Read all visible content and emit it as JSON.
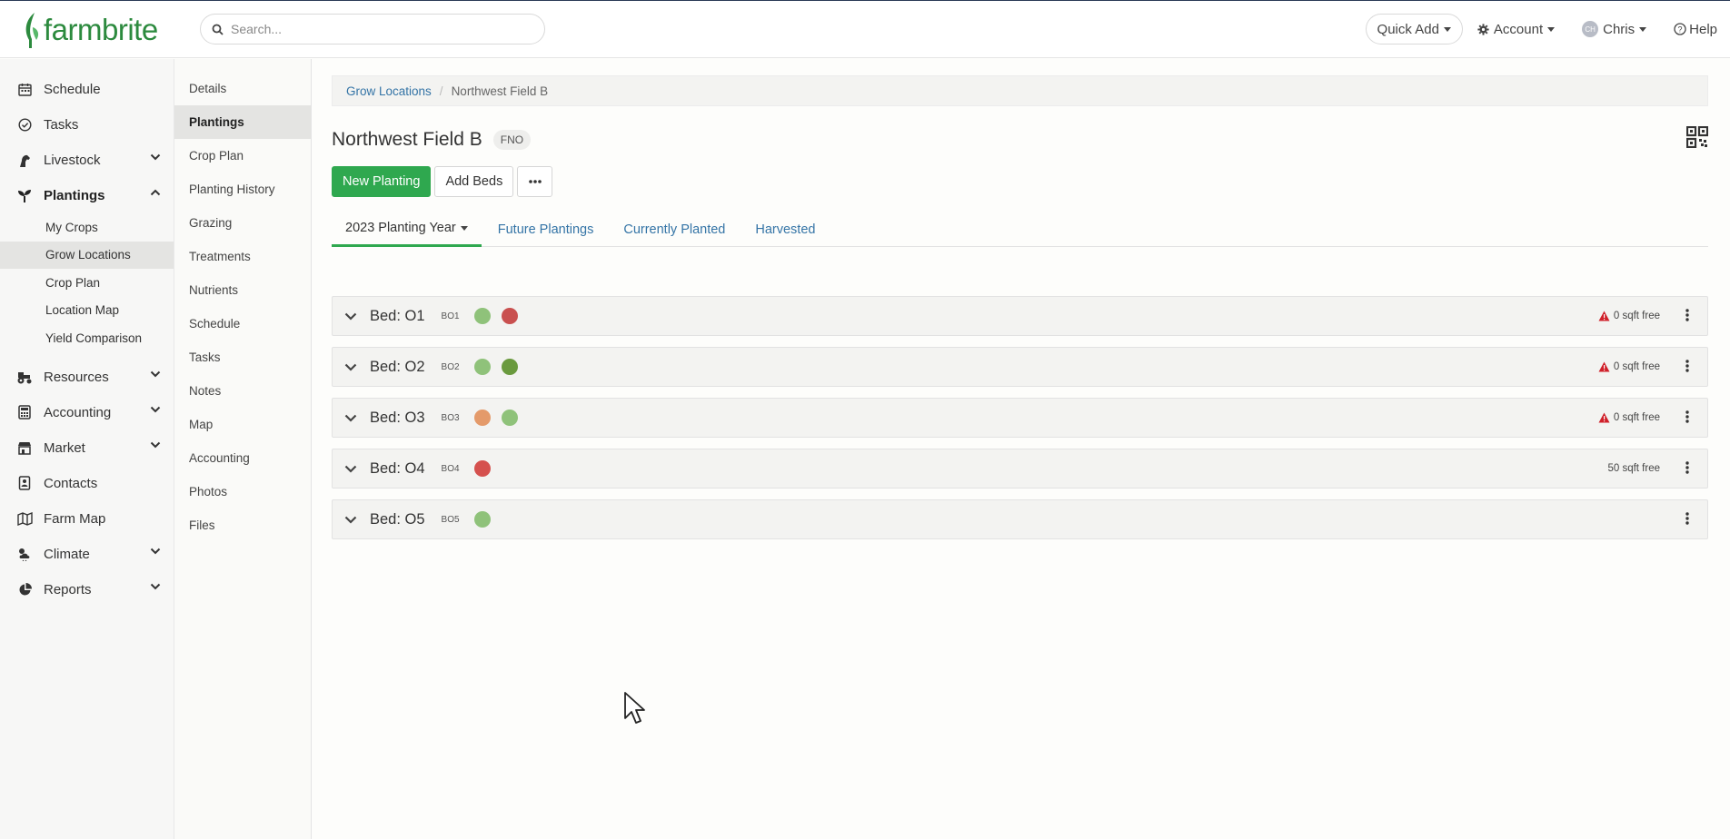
{
  "brand": {
    "name": "farmbrite",
    "color": "#2c8a3e"
  },
  "search": {
    "placeholder": "Search..."
  },
  "topbar": {
    "quick_add": "Quick Add",
    "account": "Account",
    "user_initials": "CH",
    "user_name": "Chris",
    "help": "Help"
  },
  "sidebar": {
    "items": [
      {
        "label": "Schedule",
        "icon": "calendar-icon"
      },
      {
        "label": "Tasks",
        "icon": "check-circle-icon"
      },
      {
        "label": "Livestock",
        "icon": "horse-icon",
        "expandable": true
      },
      {
        "label": "Plantings",
        "icon": "seedling-icon",
        "expanded": true
      },
      {
        "label": "Resources",
        "icon": "tractor-icon",
        "expandable": true
      },
      {
        "label": "Accounting",
        "icon": "calculator-icon",
        "expandable": true
      },
      {
        "label": "Market",
        "icon": "store-icon",
        "expandable": true
      },
      {
        "label": "Contacts",
        "icon": "address-book-icon"
      },
      {
        "label": "Farm Map",
        "icon": "map-icon"
      },
      {
        "label": "Climate",
        "icon": "cloud-sun-icon",
        "expandable": true
      },
      {
        "label": "Reports",
        "icon": "pie-chart-icon",
        "expandable": true
      }
    ],
    "plantings_sub": [
      "My Crops",
      "Grow Locations",
      "Crop Plan",
      "Location Map",
      "Yield Comparison"
    ],
    "active_sub": "Grow Locations"
  },
  "subnav": {
    "items": [
      "Details",
      "Plantings",
      "Crop Plan",
      "Planting History",
      "Grazing",
      "Treatments",
      "Nutrients",
      "Schedule",
      "Tasks",
      "Notes",
      "Map",
      "Accounting",
      "Photos",
      "Files"
    ],
    "active": "Plantings"
  },
  "breadcrumb": {
    "parent": "Grow Locations",
    "current": "Northwest Field B"
  },
  "page": {
    "title": "Northwest Field B",
    "code": "FNO"
  },
  "buttons": {
    "new_planting": "New Planting",
    "add_beds": "Add Beds",
    "more": "•••"
  },
  "tabs": [
    "2023 Planting Year",
    "Future Plantings",
    "Currently Planted",
    "Harvested"
  ],
  "beds": [
    {
      "name": "Bed: O1",
      "code": "BO1",
      "crops": [
        "#8fc27a",
        "#c9504f"
      ],
      "free": "0 sqft free",
      "warning": true
    },
    {
      "name": "Bed: O2",
      "code": "BO2",
      "crops": [
        "#8fc27a",
        "#6a9a3e"
      ],
      "free": "0 sqft free",
      "warning": true
    },
    {
      "name": "Bed: O3",
      "code": "BO3",
      "crops": [
        "#e49a6a",
        "#8fc27a"
      ],
      "free": "0 sqft free",
      "warning": true
    },
    {
      "name": "Bed: O4",
      "code": "BO4",
      "crops": [
        "#d5514e"
      ],
      "free": "50 sqft free",
      "warning": false
    },
    {
      "name": "Bed: O5",
      "code": "BO5",
      "crops": [
        "#8fc27a"
      ],
      "free": "",
      "warning": false
    }
  ],
  "colors": {
    "primary": "#2fa84f",
    "link": "#3474a6",
    "warning": "#d0202a"
  }
}
